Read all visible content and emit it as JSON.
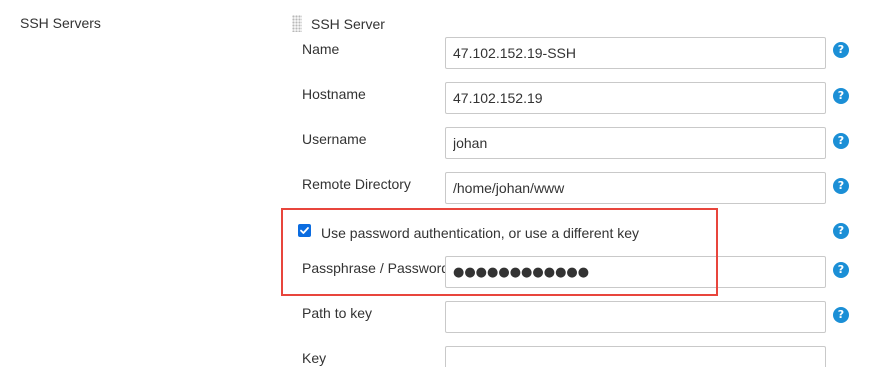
{
  "section": {
    "label": "SSH Servers"
  },
  "ssh_server": {
    "title": "SSH Server",
    "name": {
      "label": "Name",
      "value": "47.102.152.19-SSH"
    },
    "hostname": {
      "label": "Hostname",
      "value": "47.102.152.19"
    },
    "username": {
      "label": "Username",
      "value": "johan"
    },
    "remote_directory": {
      "label": "Remote Directory",
      "value": "/home/johan/www"
    },
    "use_password_auth": {
      "label": "Use password authentication, or use a different key",
      "checked": true
    },
    "passphrase": {
      "label": "Passphrase / Password",
      "value": "●●●●●●●●●●●●"
    },
    "path_to_key": {
      "label": "Path to key",
      "value": ""
    },
    "key": {
      "label": "Key",
      "value": ""
    }
  },
  "help": {
    "glyph": "?"
  },
  "colors": {
    "help_icon": "#1b8fd6",
    "checkbox": "#0b6ce0",
    "highlight": "#e8453c",
    "input_border": "#c9c9c9",
    "text": "#333333"
  },
  "icons": {
    "grip": "drag-handle-icon",
    "help": "help-icon",
    "check": "checkmark-icon"
  }
}
